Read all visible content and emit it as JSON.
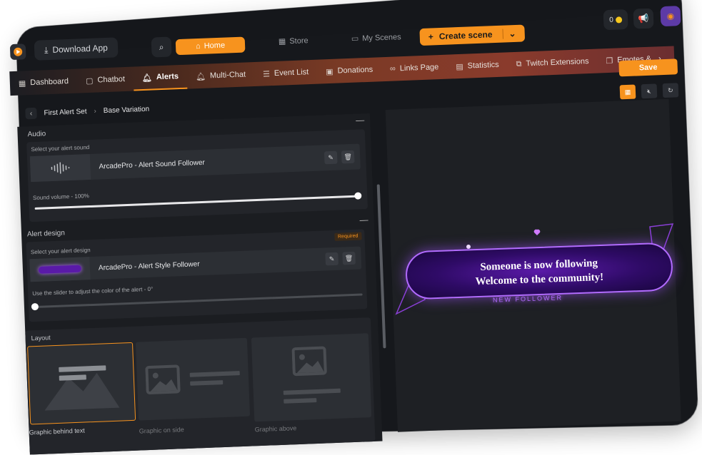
{
  "topbar": {
    "download_label": "Download App",
    "home_label": "Home",
    "store_label": "Store",
    "scenes_label": "My Scenes",
    "create_label": "Create scene",
    "coins": "0"
  },
  "tabs": [
    {
      "label": "Dashboard",
      "icon": "grid-icon"
    },
    {
      "label": "Chatbot",
      "icon": "chat-icon"
    },
    {
      "label": "Alerts",
      "icon": "bell-icon",
      "active": true
    },
    {
      "label": "Multi-Chat",
      "icon": "bell-icon"
    },
    {
      "label": "Event List",
      "icon": "list-icon"
    },
    {
      "label": "Donations",
      "icon": "gift-icon"
    },
    {
      "label": "Links Page",
      "icon": "link-icon"
    },
    {
      "label": "Statistics",
      "icon": "chart-icon"
    },
    {
      "label": "Twitch Extensions",
      "icon": "puzzle-icon"
    },
    {
      "label": "Emotes &",
      "icon": "copy-icon"
    }
  ],
  "save_label": "Save",
  "breadcrumb": {
    "parent": "First Alert Set",
    "current": "Base Variation"
  },
  "audio": {
    "title": "Audio",
    "select_label": "Select your alert sound",
    "sound_name": "ArcadePro - Alert Sound Follower",
    "volume_label": "Sound volume - 100%",
    "volume_fraction": 1.0
  },
  "design": {
    "title": "Alert design",
    "select_label": "Select your alert design",
    "required": "Required",
    "design_name": "ArcadePro - Alert Style Follower",
    "color_label": "Use the slider to adjust the color of the alert - 0°",
    "color_fraction": 0.0
  },
  "layout": {
    "title": "Layout",
    "options": [
      "Graphic behind text",
      "Graphic on side",
      "Graphic above"
    ],
    "selected_index": 0
  },
  "preview": {
    "line1": "Someone is now following",
    "line2": "Welcome to the community!",
    "sub": "NEW FOLLOWER"
  },
  "colors": {
    "accent": "#f7931e",
    "alert_purple": "#b26bff"
  }
}
